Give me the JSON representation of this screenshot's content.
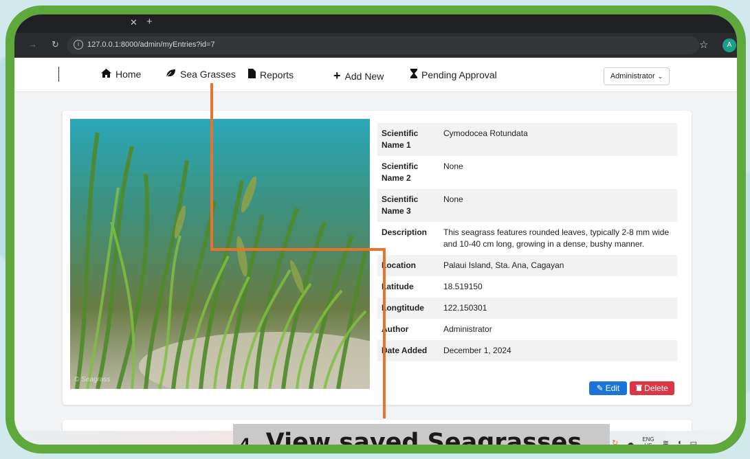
{
  "browser": {
    "url": "127.0.0.1:8000/admin/myEntries?id=7",
    "profile_initial": "A"
  },
  "navbar": {
    "items": [
      {
        "label": "Home",
        "icon": "home-icon"
      },
      {
        "label": "Sea Grasses",
        "icon": "leaf-icon"
      },
      {
        "label": "Reports",
        "icon": "file-icon"
      },
      {
        "label": "Add New",
        "icon": "plus-icon"
      },
      {
        "label": "Pending Approval",
        "icon": "hourglass-icon"
      }
    ],
    "user_dropdown": "Administrator"
  },
  "entry": {
    "photo_watermark": "© Seagrass",
    "rows": [
      {
        "key": "Scientific Name 1",
        "value": "Cymodocea Rotundata"
      },
      {
        "key": "Scientific Name 2",
        "value": "None"
      },
      {
        "key": "Scientific Name 3",
        "value": "None"
      },
      {
        "key": "Description",
        "value": "This seagrass features rounded leaves, typically 2-8 mm wide and 10-40 cm long, growing in a dense, bushy manner."
      },
      {
        "key": "Location",
        "value": "Palaui Island, Sta. Ana, Cagayan"
      },
      {
        "key": "Latitude",
        "value": "18.519150"
      },
      {
        "key": "Longtitude",
        "value": "122.150301"
      },
      {
        "key": "Author",
        "value": "Administrator"
      },
      {
        "key": "Date Added",
        "value": "December 1, 2024"
      }
    ],
    "edit_label": "Edit",
    "delete_label": "Delete"
  },
  "taskbar": {
    "lang_top": "ENG",
    "lang_bottom": "US"
  },
  "caption": {
    "number": "4.",
    "text": "View saved Seagrasses"
  },
  "colors": {
    "frame": "#5fa83b",
    "annotation": "#e8732f",
    "edit": "#1a73d6",
    "delete": "#dc3545"
  }
}
